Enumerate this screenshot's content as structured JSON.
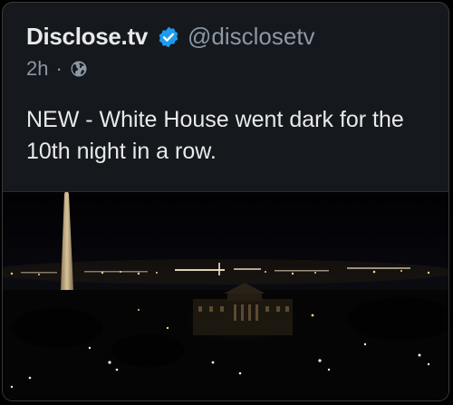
{
  "tweet": {
    "display_name": "Disclose.tv",
    "handle": "@disclosetv",
    "time": "2h",
    "separator": "·",
    "text": "NEW - White House went dark for the 10th night in a row.",
    "verified_icon": "verified-badge-icon",
    "visibility_icon": "globe-icon"
  },
  "media": {
    "description_icon": "photo"
  },
  "colors": {
    "background": "#15181c",
    "text_primary": "#e7e9ea",
    "text_secondary": "#8b98a5",
    "verified_blue": "#1d9bf0"
  }
}
